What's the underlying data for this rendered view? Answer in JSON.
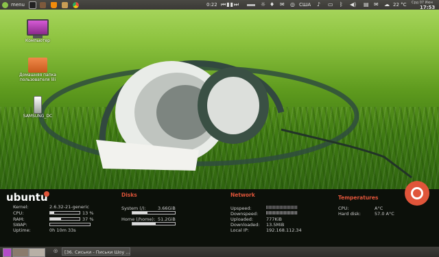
{
  "topbar": {
    "menu_label": "menu",
    "time_played": "0:22",
    "keyboard_layout": "США",
    "temperature": "22 °C",
    "date": "Срд 07 Июн",
    "clock": "17:53"
  },
  "desktop_icons": [
    {
      "label": "Компьютер",
      "icon": "computer-icon"
    },
    {
      "label": "Домашняя папка пользователя lili",
      "icon": "home-folder-icon"
    },
    {
      "label": "SAMSUNG_DC",
      "icon": "usb-drive-icon"
    }
  ],
  "conky": {
    "logo": "ubuntu",
    "system": {
      "kernel_label": "Kernel:",
      "kernel_value": "2.6.32-21-generic",
      "cpu_label": "CPU:",
      "cpu_value": "13 %",
      "cpu_level": 13,
      "ram_label": "RAM:",
      "ram_value": "37 %",
      "ram_level": 37,
      "swap_label": "SWAP:",
      "swap_level": 0,
      "uptime_label": "Uptime:",
      "uptime_value": "0h 10m 33s"
    },
    "disks": {
      "title": "Disks",
      "system_label": "System (/):",
      "system_value": "3.66GiB",
      "system_level": 35,
      "home_label": "Home (/home):",
      "home_value": "51.2GiB",
      "home_level": 55
    },
    "network": {
      "title": "Network",
      "upspeed_label": "Upspeed:",
      "downspeed_label": "Downspeed:",
      "uploaded_label": "Uploaded:",
      "uploaded_value": "777KiB",
      "downloaded_label": "Downloaded:",
      "downloaded_value": "13.5MiB",
      "ip_label": "Local IP:",
      "ip_value": "192.168.112.34"
    },
    "temperatures": {
      "title": "Temperatures",
      "cpu_label": "CPU:",
      "cpu_value": "A°C",
      "disk_label": "Hard disk:",
      "disk_value": "57.0 A°C"
    }
  },
  "taskbar": {
    "window_title": "[36. Сиськи - Письки Шоу ..."
  }
}
